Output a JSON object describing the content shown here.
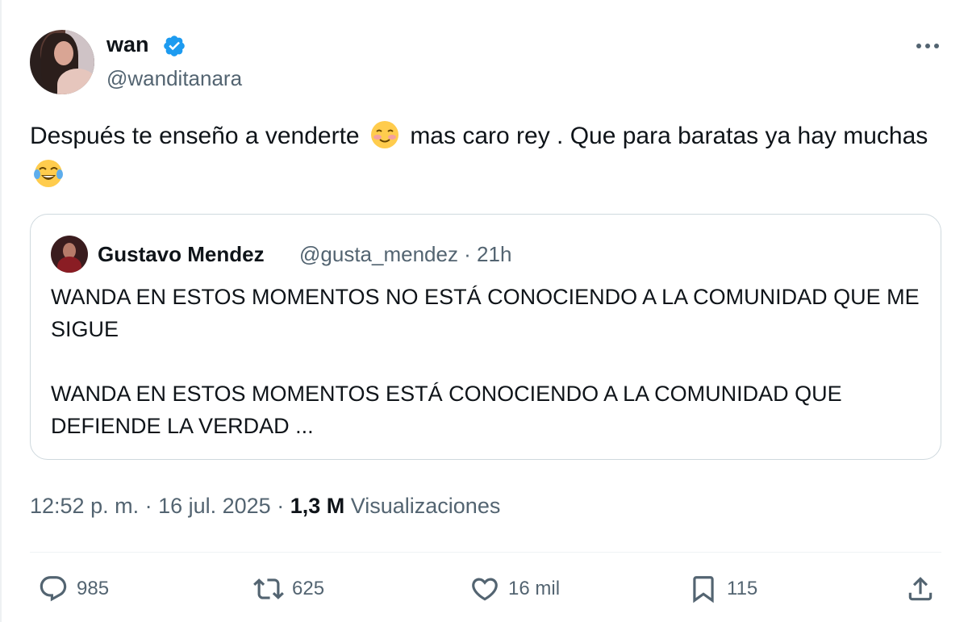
{
  "author": {
    "name": "wan",
    "handle": "@wanditanara",
    "verified_color": "#1d9bf0"
  },
  "tweet": {
    "text_part1": "Después te enseño a venderte",
    "text_part2": "mas caro rey .  Que para baratas ya hay muchas",
    "emoji1": "smiling-face-with-hearts-icon",
    "emoji2": "face-with-tears-of-joy-icon"
  },
  "quote": {
    "name": "Gustavo Mendez",
    "meta": "@gusta_mendez · 21h",
    "paragraph1": "WANDA EN ESTOS MOMENTOS NO ESTÁ CONOCIENDO A LA COMUNIDAD QUE ME SIGUE",
    "paragraph2": "WANDA EN ESTOS MOMENTOS ESTÁ CONOCIENDO A LA COMUNIDAD QUE DEFIENDE LA VERDAD ..."
  },
  "footer": {
    "timestamp": "12:52 p. m. · 16 jul. 2025 · ",
    "views_count": "1,3 M",
    "views_label": " Visualizaciones"
  },
  "actions": {
    "replies": "985",
    "reposts": "625",
    "likes": "16 mil",
    "bookmarks": "115"
  },
  "colors": {
    "text_primary": "#0f1419",
    "text_secondary": "#536471",
    "border": "#cfd9de"
  }
}
